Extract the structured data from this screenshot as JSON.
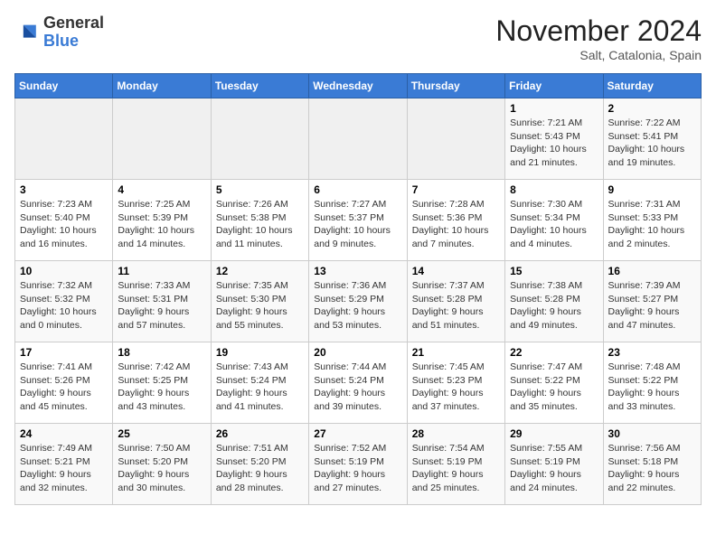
{
  "logo": {
    "general": "General",
    "blue": "Blue"
  },
  "header": {
    "month": "November 2024",
    "location": "Salt, Catalonia, Spain"
  },
  "weekdays": [
    "Sunday",
    "Monday",
    "Tuesday",
    "Wednesday",
    "Thursday",
    "Friday",
    "Saturday"
  ],
  "weeks": [
    [
      {
        "day": "",
        "info": ""
      },
      {
        "day": "",
        "info": ""
      },
      {
        "day": "",
        "info": ""
      },
      {
        "day": "",
        "info": ""
      },
      {
        "day": "",
        "info": ""
      },
      {
        "day": "1",
        "info": "Sunrise: 7:21 AM\nSunset: 5:43 PM\nDaylight: 10 hours and 21 minutes."
      },
      {
        "day": "2",
        "info": "Sunrise: 7:22 AM\nSunset: 5:41 PM\nDaylight: 10 hours and 19 minutes."
      }
    ],
    [
      {
        "day": "3",
        "info": "Sunrise: 7:23 AM\nSunset: 5:40 PM\nDaylight: 10 hours and 16 minutes."
      },
      {
        "day": "4",
        "info": "Sunrise: 7:25 AM\nSunset: 5:39 PM\nDaylight: 10 hours and 14 minutes."
      },
      {
        "day": "5",
        "info": "Sunrise: 7:26 AM\nSunset: 5:38 PM\nDaylight: 10 hours and 11 minutes."
      },
      {
        "day": "6",
        "info": "Sunrise: 7:27 AM\nSunset: 5:37 PM\nDaylight: 10 hours and 9 minutes."
      },
      {
        "day": "7",
        "info": "Sunrise: 7:28 AM\nSunset: 5:36 PM\nDaylight: 10 hours and 7 minutes."
      },
      {
        "day": "8",
        "info": "Sunrise: 7:30 AM\nSunset: 5:34 PM\nDaylight: 10 hours and 4 minutes."
      },
      {
        "day": "9",
        "info": "Sunrise: 7:31 AM\nSunset: 5:33 PM\nDaylight: 10 hours and 2 minutes."
      }
    ],
    [
      {
        "day": "10",
        "info": "Sunrise: 7:32 AM\nSunset: 5:32 PM\nDaylight: 10 hours and 0 minutes."
      },
      {
        "day": "11",
        "info": "Sunrise: 7:33 AM\nSunset: 5:31 PM\nDaylight: 9 hours and 57 minutes."
      },
      {
        "day": "12",
        "info": "Sunrise: 7:35 AM\nSunset: 5:30 PM\nDaylight: 9 hours and 55 minutes."
      },
      {
        "day": "13",
        "info": "Sunrise: 7:36 AM\nSunset: 5:29 PM\nDaylight: 9 hours and 53 minutes."
      },
      {
        "day": "14",
        "info": "Sunrise: 7:37 AM\nSunset: 5:28 PM\nDaylight: 9 hours and 51 minutes."
      },
      {
        "day": "15",
        "info": "Sunrise: 7:38 AM\nSunset: 5:28 PM\nDaylight: 9 hours and 49 minutes."
      },
      {
        "day": "16",
        "info": "Sunrise: 7:39 AM\nSunset: 5:27 PM\nDaylight: 9 hours and 47 minutes."
      }
    ],
    [
      {
        "day": "17",
        "info": "Sunrise: 7:41 AM\nSunset: 5:26 PM\nDaylight: 9 hours and 45 minutes."
      },
      {
        "day": "18",
        "info": "Sunrise: 7:42 AM\nSunset: 5:25 PM\nDaylight: 9 hours and 43 minutes."
      },
      {
        "day": "19",
        "info": "Sunrise: 7:43 AM\nSunset: 5:24 PM\nDaylight: 9 hours and 41 minutes."
      },
      {
        "day": "20",
        "info": "Sunrise: 7:44 AM\nSunset: 5:24 PM\nDaylight: 9 hours and 39 minutes."
      },
      {
        "day": "21",
        "info": "Sunrise: 7:45 AM\nSunset: 5:23 PM\nDaylight: 9 hours and 37 minutes."
      },
      {
        "day": "22",
        "info": "Sunrise: 7:47 AM\nSunset: 5:22 PM\nDaylight: 9 hours and 35 minutes."
      },
      {
        "day": "23",
        "info": "Sunrise: 7:48 AM\nSunset: 5:22 PM\nDaylight: 9 hours and 33 minutes."
      }
    ],
    [
      {
        "day": "24",
        "info": "Sunrise: 7:49 AM\nSunset: 5:21 PM\nDaylight: 9 hours and 32 minutes."
      },
      {
        "day": "25",
        "info": "Sunrise: 7:50 AM\nSunset: 5:20 PM\nDaylight: 9 hours and 30 minutes."
      },
      {
        "day": "26",
        "info": "Sunrise: 7:51 AM\nSunset: 5:20 PM\nDaylight: 9 hours and 28 minutes."
      },
      {
        "day": "27",
        "info": "Sunrise: 7:52 AM\nSunset: 5:19 PM\nDaylight: 9 hours and 27 minutes."
      },
      {
        "day": "28",
        "info": "Sunrise: 7:54 AM\nSunset: 5:19 PM\nDaylight: 9 hours and 25 minutes."
      },
      {
        "day": "29",
        "info": "Sunrise: 7:55 AM\nSunset: 5:19 PM\nDaylight: 9 hours and 24 minutes."
      },
      {
        "day": "30",
        "info": "Sunrise: 7:56 AM\nSunset: 5:18 PM\nDaylight: 9 hours and 22 minutes."
      }
    ]
  ]
}
